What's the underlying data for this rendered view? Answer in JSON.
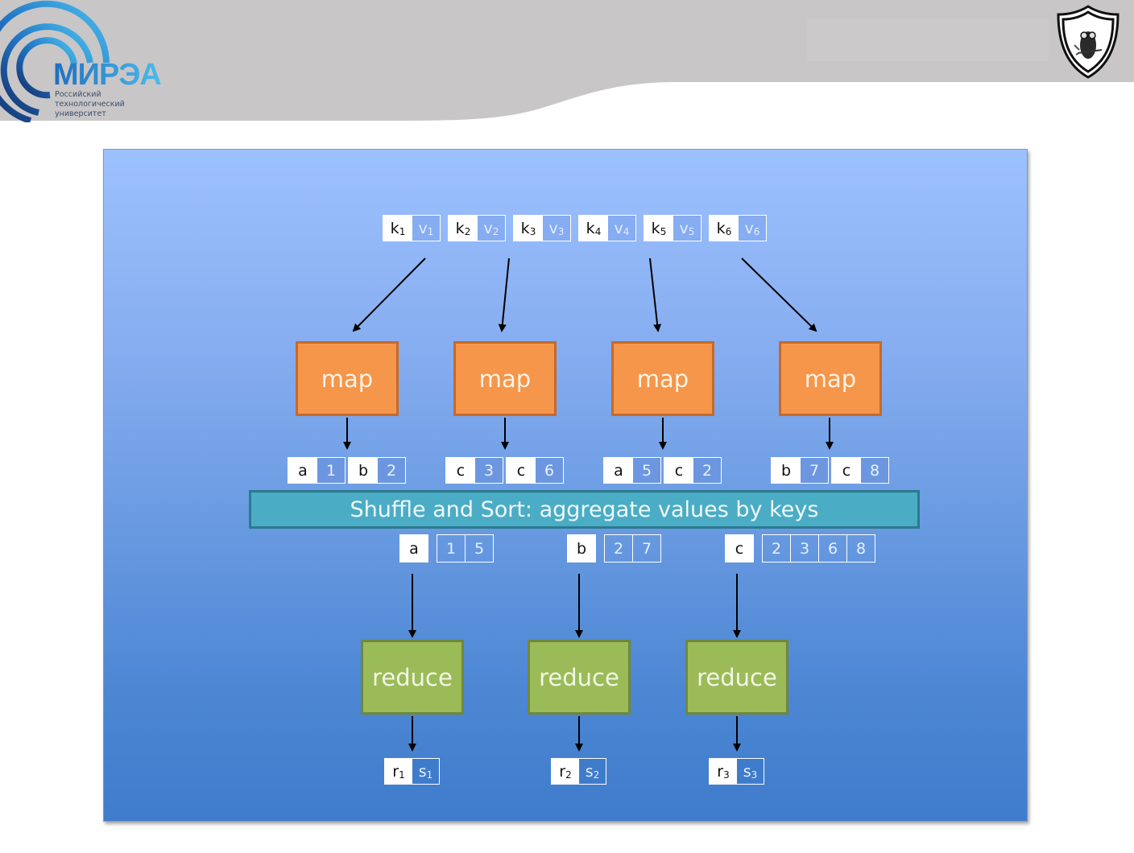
{
  "header": {
    "logo": {
      "wordmark": "МИРЭА",
      "subtitle_lines": [
        "Российский",
        "технологический",
        "университет"
      ]
    },
    "crest_icon": "owl-shield-crest",
    "colors": {
      "band": "#c8c6c7",
      "logo_blue_dark": "#1e5aa8",
      "logo_blue_light": "#4dbbe9"
    }
  },
  "diagram": {
    "colors": {
      "panel_top": "#9dc1fe",
      "panel_bottom": "#3f7ccb",
      "map_fill": "#f5964a",
      "reduce_fill": "#9bbb58",
      "shuffle_fill": "#4bacc5"
    },
    "inputs": [
      {
        "k": "k",
        "ks": "1",
        "v": "v",
        "vs": "1"
      },
      {
        "k": "k",
        "ks": "2",
        "v": "v",
        "vs": "2"
      },
      {
        "k": "k",
        "ks": "3",
        "v": "v",
        "vs": "3"
      },
      {
        "k": "k",
        "ks": "4",
        "v": "v",
        "vs": "4"
      },
      {
        "k": "k",
        "ks": "5",
        "v": "v",
        "vs": "5"
      },
      {
        "k": "k",
        "ks": "6",
        "v": "v",
        "vs": "6"
      }
    ],
    "mappers": [
      {
        "label": "map",
        "outputs": [
          {
            "k": "a",
            "v": "1"
          },
          {
            "k": "b",
            "v": "2"
          }
        ]
      },
      {
        "label": "map",
        "outputs": [
          {
            "k": "c",
            "v": "3"
          },
          {
            "k": "c",
            "v": "6"
          }
        ]
      },
      {
        "label": "map",
        "outputs": [
          {
            "k": "a",
            "v": "5"
          },
          {
            "k": "c",
            "v": "2"
          }
        ]
      },
      {
        "label": "map",
        "outputs": [
          {
            "k": "b",
            "v": "7"
          },
          {
            "k": "c",
            "v": "8"
          }
        ]
      }
    ],
    "shuffle_label": "Shuffle and Sort: aggregate values by keys",
    "groups": [
      {
        "key": "a",
        "values": [
          "1",
          "5"
        ]
      },
      {
        "key": "b",
        "values": [
          "2",
          "7"
        ]
      },
      {
        "key": "c",
        "values": [
          "2",
          "3",
          "6",
          "8"
        ]
      }
    ],
    "reducers": [
      {
        "label": "reduce",
        "output": {
          "r": "r",
          "rs": "1",
          "s": "s",
          "ss": "1"
        }
      },
      {
        "label": "reduce",
        "output": {
          "r": "r",
          "rs": "2",
          "s": "s",
          "ss": "2"
        }
      },
      {
        "label": "reduce",
        "output": {
          "r": "r",
          "rs": "3",
          "s": "s",
          "ss": "3"
        }
      }
    ]
  }
}
